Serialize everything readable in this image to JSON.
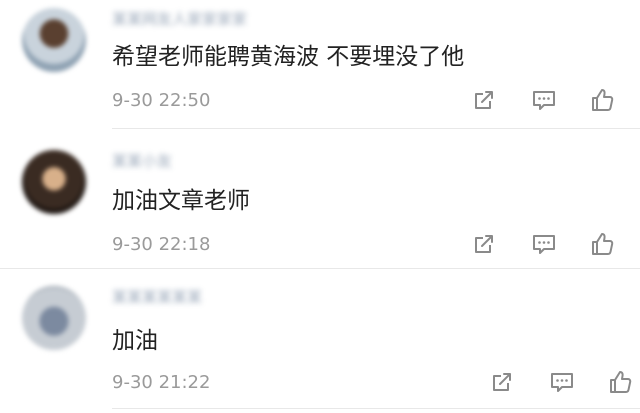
{
  "comments": [
    {
      "username": "某某网友人家家家家",
      "text": "希望老师能聘黄海波 不要埋没了他",
      "time": "9-30 22:50"
    },
    {
      "username": "某某小友",
      "text": "加油文章老师",
      "time": "9-30 22:18"
    },
    {
      "username": "某某某某某某",
      "text": "加油",
      "time": "9-30 21:22"
    }
  ],
  "icons": {
    "share": "share-icon",
    "reply": "comment-icon",
    "like": "thumbs-up-icon"
  },
  "colors": {
    "text": "#222222",
    "time": "#9a9a9a",
    "username": "#6b7f99",
    "icon": "#8a8a8a",
    "divider": "#e8e8e8"
  }
}
